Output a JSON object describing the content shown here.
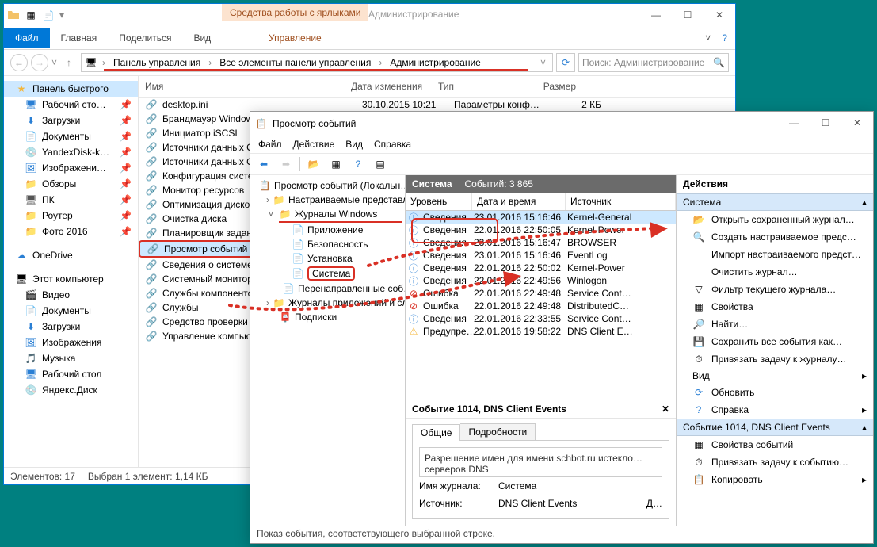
{
  "explorer": {
    "tooltab": "Средства работы с ярлыками",
    "title": "Администрирование",
    "tabs": {
      "file": "Файл",
      "home": "Главная",
      "share": "Поделиться",
      "view": "Вид",
      "manage": "Управление"
    },
    "breadcrumb": [
      "Панель управления",
      "Все элементы панели управления",
      "Администрирование"
    ],
    "search_placeholder": "Поиск: Администрирование",
    "nav": {
      "quick": "Панель быстрого",
      "quick_items": [
        "Рабочий сто…",
        "Загрузки",
        "Документы",
        "YandexDisk-k…",
        "Изображени…",
        "Обзоры",
        "ПК",
        "Роутер",
        "Фото 2016"
      ],
      "onedrive": "OneDrive",
      "thispc": "Этот компьютер",
      "thispc_items": [
        "Видео",
        "Документы",
        "Загрузки",
        "Изображения",
        "Музыка",
        "Рабочий стол",
        "Яндекс.Диск"
      ]
    },
    "columns": {
      "name": "Имя",
      "date": "Дата изменения",
      "type": "Тип",
      "size": "Размер"
    },
    "files": [
      {
        "name": "desktop.ini",
        "date": "30.10.2015 10:21",
        "type": "Параметры конф…",
        "size": "2 КБ"
      },
      {
        "name": "Брандмауэр Window…"
      },
      {
        "name": "Инициатор iSCSI"
      },
      {
        "name": "Источники данных O…"
      },
      {
        "name": "Источники данных O…"
      },
      {
        "name": "Конфигурация систе…"
      },
      {
        "name": "Монитор ресурсов"
      },
      {
        "name": "Оптимизация дисков"
      },
      {
        "name": "Очистка диска"
      },
      {
        "name": "Планировщик задани…"
      },
      {
        "name": "Просмотр событий",
        "selected": true
      },
      {
        "name": "Сведения о системе"
      },
      {
        "name": "Системный монитор"
      },
      {
        "name": "Службы компоненто…"
      },
      {
        "name": "Службы"
      },
      {
        "name": "Средство проверки …"
      },
      {
        "name": "Управление компью…"
      }
    ],
    "status": {
      "count": "Элементов: 17",
      "sel": "Выбран 1 элемент: 1,14 КБ"
    }
  },
  "eventviewer": {
    "title": "Просмотр событий",
    "menu": [
      "Файл",
      "Действие",
      "Вид",
      "Справка"
    ],
    "tree": {
      "root": "Просмотр событий (Локальн…",
      "custom": "Настраиваемые представле…",
      "winlogs": "Журналы Windows",
      "winlogs_items": [
        "Приложение",
        "Безопасность",
        "Установка",
        "Система",
        "Перенаправленные соб…"
      ],
      "applogs": "Журналы приложений и сл…",
      "subs": "Подписки"
    },
    "mid": {
      "title": "Система",
      "count_label": "Событий: 3 865",
      "cols": {
        "level": "Уровень",
        "dt": "Дата и время",
        "src": "Источник"
      },
      "rows": [
        {
          "icon": "info",
          "level": "Сведения",
          "dt": "23.01.2016 15:16:46",
          "src": "Kernel-General",
          "sel": true
        },
        {
          "icon": "info",
          "level": "Сведения",
          "dt": "22.01.2016 22:50:05",
          "src": "Kernel-Power"
        },
        {
          "icon": "info",
          "level": "Сведения",
          "dt": "23.01.2016 15:16:47",
          "src": "BROWSER"
        },
        {
          "icon": "info",
          "level": "Сведения",
          "dt": "23.01.2016 15:16:46",
          "src": "EventLog"
        },
        {
          "icon": "info",
          "level": "Сведения",
          "dt": "22.01.2016 22:50:02",
          "src": "Kernel-Power"
        },
        {
          "icon": "info",
          "level": "Сведения",
          "dt": "22.01.2016 22:49:56",
          "src": "Winlogon"
        },
        {
          "icon": "error",
          "level": "Ошибка",
          "dt": "22.01.2016 22:49:48",
          "src": "Service Cont…"
        },
        {
          "icon": "error",
          "level": "Ошибка",
          "dt": "22.01.2016 22:49:48",
          "src": "DistributedC…"
        },
        {
          "icon": "info",
          "level": "Сведения",
          "dt": "22.01.2016 22:33:55",
          "src": "Service Cont…"
        },
        {
          "icon": "warn",
          "level": "Предупре…",
          "dt": "22.01.2016 19:58:22",
          "src": "DNS Client E…"
        }
      ],
      "preview": {
        "title": "Событие 1014, DNS Client Events",
        "tabs": {
          "general": "Общие",
          "details": "Подробности"
        },
        "msg": "Разрешение имен для имени schbot.ru истекло…",
        "msg2": "серверов DNS",
        "logname_k": "Имя журнала:",
        "logname_v": "Система",
        "source_k": "Источник:",
        "source_v": "DNS Client Events",
        "date_k": "Д…"
      }
    },
    "actions": {
      "hdr": "Действия",
      "section1": "Система",
      "items1": [
        "Открыть сохраненный журнал…",
        "Создать настраиваемое предс…",
        "Импорт настраиваемого предст…",
        "Очистить журнал…",
        "Фильтр текущего журнала…",
        "Свойства",
        "Найти…",
        "Сохранить все события как…",
        "Привязать задачу к журналу…"
      ],
      "view": "Вид",
      "refresh": "Обновить",
      "help": "Справка",
      "section2": "Событие 1014, DNS Client Events",
      "items2": [
        "Свойства событий",
        "Привязать задачу к событию…",
        "Копировать"
      ]
    },
    "status": "Показ события, соответствующего выбранной строке."
  }
}
